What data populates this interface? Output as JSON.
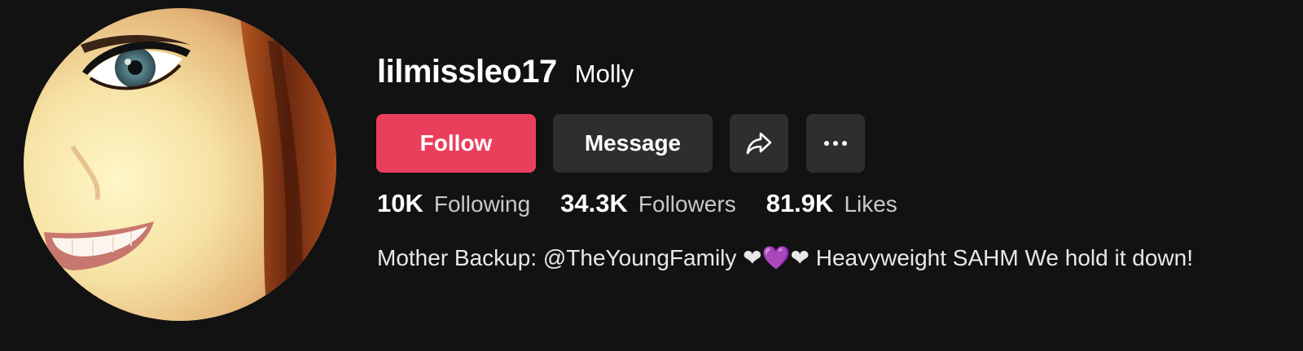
{
  "profile": {
    "username": "lilmissleo17",
    "nickname": "Molly",
    "bio": "Mother Backup: @TheYoungFamily ❤💜❤ Heavyweight SAHM We hold it down!"
  },
  "actions": {
    "follow_label": "Follow",
    "message_label": "Message",
    "share_icon": "share-arrow-icon",
    "more_icon": "more-horizontal-icon"
  },
  "stats": {
    "following_count": "10K",
    "following_label": "Following",
    "followers_count": "34.3K",
    "followers_label": "Followers",
    "likes_count": "81.9K",
    "likes_label": "Likes"
  },
  "colors": {
    "background": "#121212",
    "follow_button": "#ea3f5c",
    "secondary_button": "#2e2e2e"
  }
}
